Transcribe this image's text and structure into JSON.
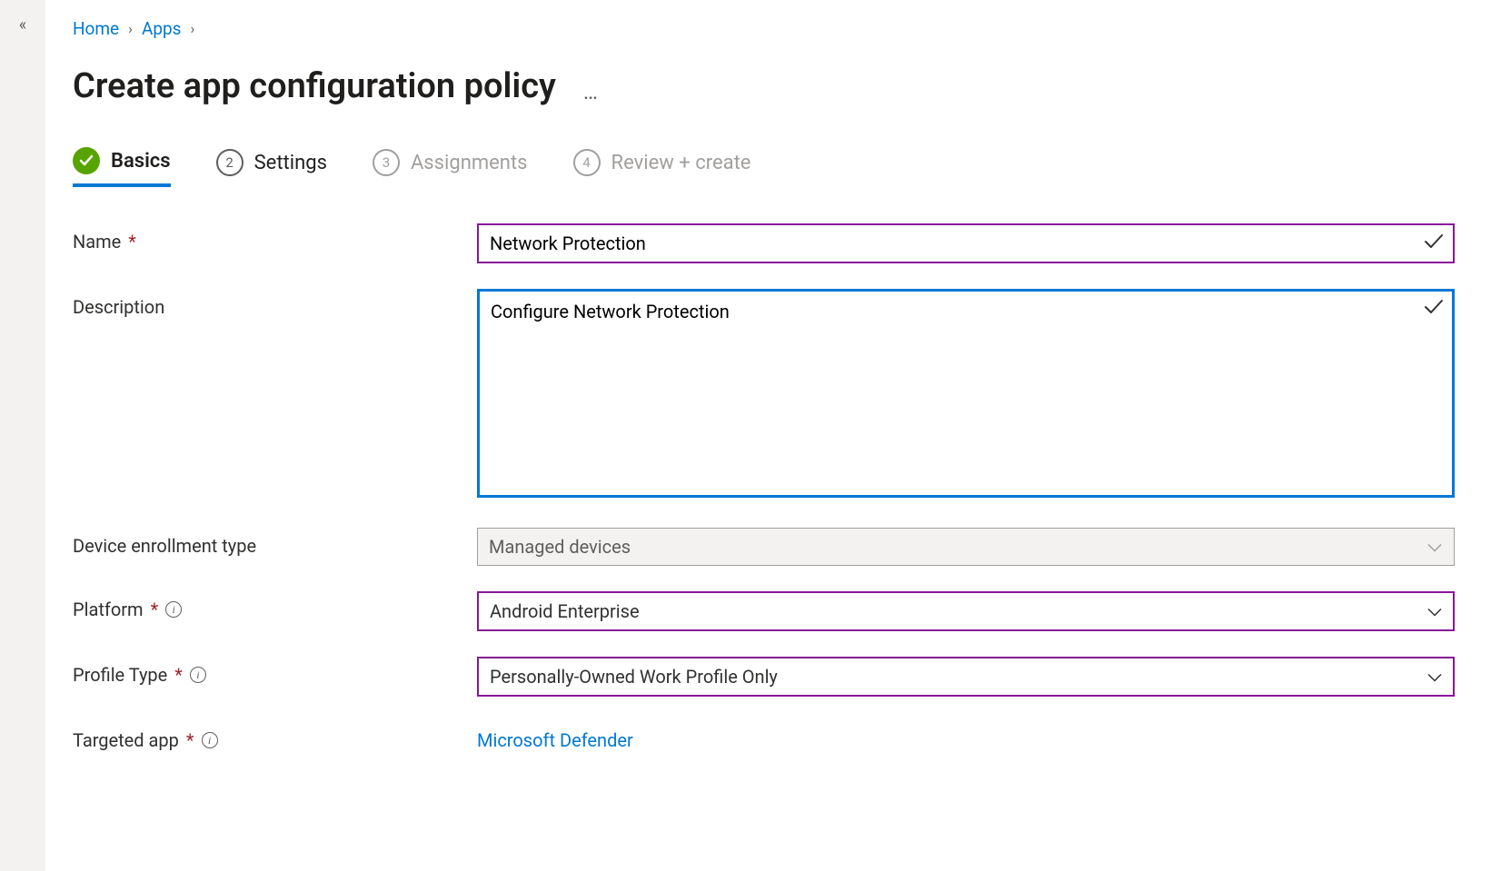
{
  "nav": {
    "home": "Home",
    "apps": "Apps"
  },
  "page": {
    "title": "Create app configuration policy",
    "more": "…"
  },
  "steps": {
    "s1": {
      "num": "✓",
      "label": "Basics"
    },
    "s2": {
      "num": "2",
      "label": "Settings"
    },
    "s3": {
      "num": "3",
      "label": "Assignments"
    },
    "s4": {
      "num": "4",
      "label": "Review + create"
    }
  },
  "form": {
    "name": {
      "label": "Name",
      "value": "Network Protection"
    },
    "description": {
      "label": "Description",
      "value": "Configure Network Protection"
    },
    "enrollment": {
      "label": "Device enrollment type",
      "value": "Managed devices"
    },
    "platform": {
      "label": "Platform",
      "value": "Android Enterprise"
    },
    "profileType": {
      "label": "Profile Type",
      "value": "Personally-Owned Work Profile Only"
    },
    "targetedApp": {
      "label": "Targeted app",
      "value": "Microsoft Defender"
    }
  }
}
